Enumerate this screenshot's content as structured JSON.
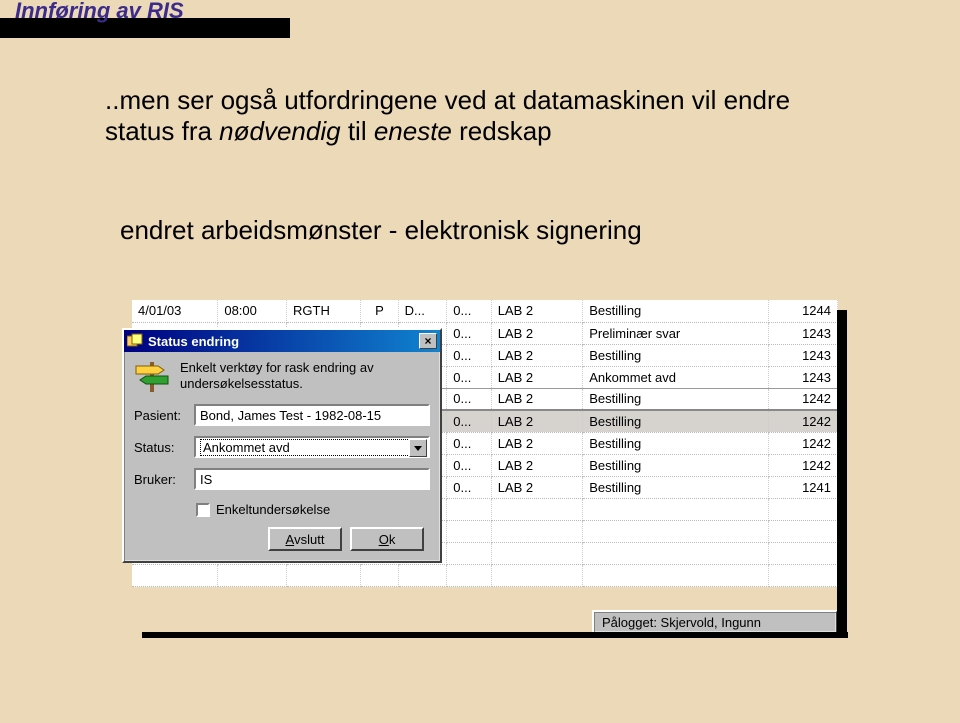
{
  "slide": {
    "header": "Innføring av RIS",
    "line1a": "..men ser også utfordringene ved at datamaskinen vil endre status fra ",
    "line1b": "nødvendig ",
    "line1c": "til ",
    "line1d": "eneste ",
    "line1e": "redskap",
    "line2": "endret arbeidsmønster   -    elektronisk signering"
  },
  "grid": {
    "rows": [
      {
        "date": "4/01/03",
        "time": "08:00",
        "user": "RGTH",
        "p": "P",
        "d": "D...",
        "dot": "0...",
        "lab": "LAB 2",
        "status": "Bestilling",
        "num": "1244",
        "sel": false
      },
      {
        "date": "",
        "time": "",
        "user": "",
        "p": "",
        "d": ".",
        "dot": "0...",
        "lab": "LAB 2",
        "status": "Preliminær svar",
        "num": "1243",
        "sel": false
      },
      {
        "date": "",
        "time": "",
        "user": "",
        "p": "",
        "d": ".",
        "dot": "0...",
        "lab": "LAB 2",
        "status": "Bestilling",
        "num": "1243",
        "sel": false
      },
      {
        "date": "",
        "time": "",
        "user": "",
        "p": "",
        "d": ".",
        "dot": "0...",
        "lab": "LAB 2",
        "status": "Ankommet avd",
        "num": "1243",
        "sel": false
      },
      {
        "date": "",
        "time": "",
        "user": "",
        "p": "",
        "d": ".",
        "dot": "0...",
        "lab": "LAB 2",
        "status": "Bestilling",
        "num": "1242",
        "sel": false
      },
      {
        "date": "",
        "time": "",
        "user": "",
        "p": "",
        "d": ".",
        "dot": "0...",
        "lab": "LAB 2",
        "status": "Bestilling",
        "num": "1242",
        "sel": true
      },
      {
        "date": "",
        "time": "",
        "user": "",
        "p": "",
        "d": ".",
        "dot": "0...",
        "lab": "LAB 2",
        "status": "Bestilling",
        "num": "1242",
        "sel": false
      },
      {
        "date": "",
        "time": "",
        "user": "",
        "p": "",
        "d": ".",
        "dot": "0...",
        "lab": "LAB 2",
        "status": "Bestilling",
        "num": "1242",
        "sel": false
      },
      {
        "date": "",
        "time": "",
        "user": "",
        "p": "",
        "d": ".",
        "dot": "0...",
        "lab": "LAB 2",
        "status": "Bestilling",
        "num": "1241",
        "sel": false
      }
    ]
  },
  "dialog": {
    "title": "Status endring",
    "hint": "Enkelt verktøy for rask endring av undersøkelsesstatus.",
    "labels": {
      "pasient": "Pasient:",
      "status": "Status:",
      "bruker": "Bruker:"
    },
    "values": {
      "pasient": "Bond, James Test - 1982-08-15",
      "status": "Ankommet avd",
      "bruker": "IS"
    },
    "checkbox": "Enkeltundersøkelse",
    "buttons": {
      "avslutt": "vslutt",
      "avslutt_u": "A",
      "ok": "k",
      "ok_u": "O"
    }
  },
  "statusbar": {
    "text": "Pålogget: Skjervold, Ingunn"
  }
}
